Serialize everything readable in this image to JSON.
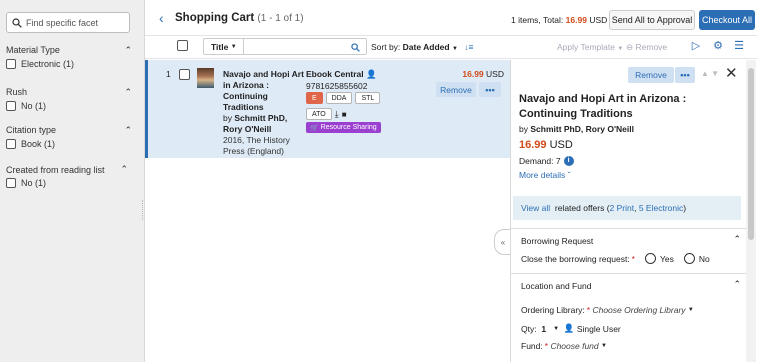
{
  "facets": {
    "search_placeholder": "Find specific facet",
    "groups": [
      {
        "title": "Material Type",
        "option": "Electronic (1)"
      },
      {
        "title": "Rush",
        "option": "No (1)"
      },
      {
        "title": "Citation type",
        "option": "Book (1)"
      },
      {
        "title": "Created from reading list",
        "option": "No (1)"
      }
    ]
  },
  "header": {
    "title": "Shopping Cart",
    "count": "(1 - 1 of 1)",
    "summary_prefix": "1 items, Total:",
    "summary_price": "16.99",
    "summary_currency": "USD",
    "send_all_label": "Send All to Approval",
    "checkout_all_label": "Checkout All"
  },
  "toolbar": {
    "title_dropdown": "Title",
    "sort_label": "Sort by:",
    "sort_value": "Date Added",
    "apply_template": "Apply Template",
    "remove": "Remove"
  },
  "item": {
    "index": "1",
    "title": "Navajo and Hopi Art in Arizona : Continuing Traditions",
    "author_prefix": "by",
    "author": "Schmitt PhD, Rory O'Neill",
    "publication": "2016, The History Press (England)",
    "vendor": "Ebook Central",
    "isbn": "9781625855602",
    "tags": [
      "E",
      "DDA",
      "STL"
    ],
    "tags2": [
      "ATO"
    ],
    "resource_sharing": "Resource Sharing",
    "price": "16.99",
    "currency": "USD",
    "remove_label": "Remove",
    "more_label": "•••"
  },
  "detail": {
    "remove_label": "Remove",
    "more_label": "•••",
    "title": "Navajo and Hopi Art in Arizona : Continuing Traditions",
    "author_prefix": "by",
    "author": "Schmitt PhD, Rory O'Neill",
    "price": "16.99",
    "currency": "USD",
    "demand": "Demand: 7",
    "more_details": "More details",
    "offers_view_all": "View all",
    "offers_text": "related offers (",
    "offers_print": "2 Print",
    "offers_electronic": "5 Electronic",
    "offers_close": ")",
    "borrowing_section": "Borrowing Request",
    "close_borrowing_label": "Close the borrowing request:",
    "yes_label": "Yes",
    "no_label": "No",
    "location_section": "Location and Fund",
    "ordering_library_label": "Ordering Library:",
    "ordering_library_placeholder": "Choose Ordering Library",
    "qty_label": "Qty:",
    "qty_value": "1",
    "user_type": "Single User",
    "fund_label": "Fund:",
    "fund_placeholder": "Choose fund"
  },
  "colors": {
    "accent": "#2c6eb5",
    "price": "#d14a1a",
    "tag_e": "#e0664a",
    "resource_sharing": "#9a3fd0"
  }
}
